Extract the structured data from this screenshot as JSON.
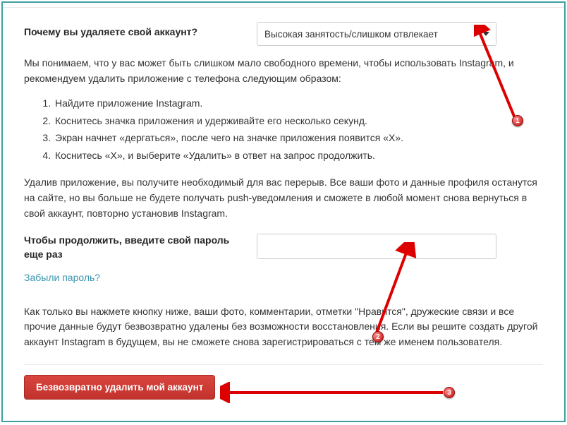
{
  "question_label": "Почему вы удаляете свой аккаунт?",
  "reason_selected": "Высокая занятость/слишком отвлекает",
  "intro_text": "Мы понимаем, что у вас может быть слишком мало свободного времени, чтобы использовать Instagram, и рекомендуем удалить приложение с телефона следующим образом:",
  "steps": [
    "Найдите приложение Instagram.",
    "Коснитесь значка приложения и удерживайте его несколько секунд.",
    "Экран начнет «дергаться», после чего на значке приложения появится «X».",
    "Коснитесь «X», и выберите «Удалить» в ответ на запрос продолжить."
  ],
  "post_steps_text": "Удалив приложение, вы получите необходимый для вас перерыв. Все ваши фото и данные профиля останутся на сайте, но вы больше не будете получать push-уведомления и сможете в любой момент снова вернуться в свой аккаунт, повторно установив Instagram.",
  "password_label": "Чтобы продолжить, введите свой пароль еще раз",
  "password_value": "",
  "forgot_link": "Забыли пароль?",
  "warning_text": "Как только вы нажмете кнопку ниже, ваши фото, комментарии, отметки \"Нравится\", дружеские связи и все прочие данные будут безвозвратно удалены без возможности восстановления. Если вы решите создать другой аккаунт Instagram в будущем, вы не сможете снова зарегистрироваться с тем же именем пользователя.",
  "delete_button": "Безвозвратно удалить мой аккаунт",
  "annotations": {
    "b1": "1",
    "b2": "2",
    "b3": "3"
  }
}
